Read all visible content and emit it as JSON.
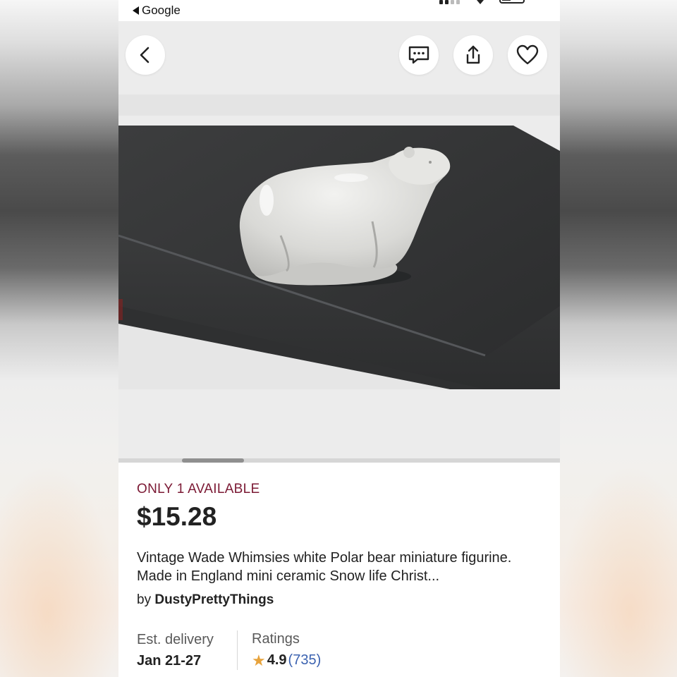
{
  "status_bar": {
    "back_app_label": "Google"
  },
  "gallery": {
    "image_alt": "White ceramic polar bear figurine on a dark grey book"
  },
  "listing": {
    "availability": "ONLY 1 AVAILABLE",
    "price": "$15.28",
    "title": "Vintage Wade Whimsies white Polar bear miniature figurine. Made in England mini ceramic Snow life Christ...",
    "seller_prefix": "by",
    "seller_name": "DustyPrettyThings",
    "delivery_label": "Est. delivery",
    "delivery_value": "Jan 21-27",
    "ratings_label": "Ratings",
    "rating_score": "4.9",
    "rating_count": "(735)"
  },
  "icons": {
    "back": "chevron-left-icon",
    "message": "message-icon",
    "share": "share-icon",
    "favorite": "heart-icon",
    "star": "star-icon"
  },
  "colors": {
    "availability": "#7b1934",
    "star": "#e7a33c",
    "rating_count": "#3b62b0"
  }
}
